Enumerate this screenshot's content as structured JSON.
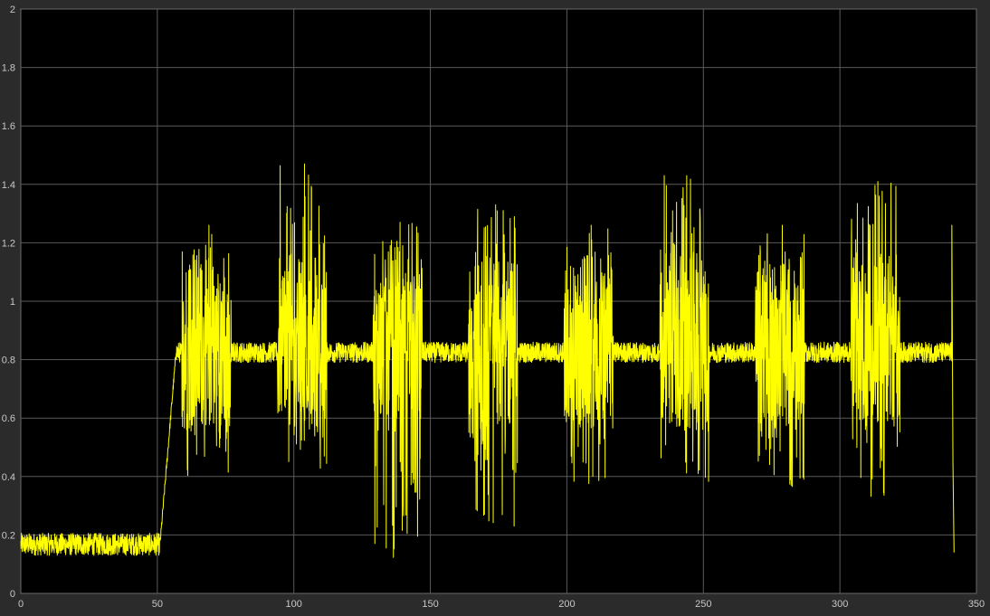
{
  "chart_data": {
    "type": "line",
    "title": "",
    "xlabel": "",
    "ylabel": "",
    "xlim": [
      0,
      350
    ],
    "ylim": [
      0,
      2
    ],
    "grid": true,
    "x_ticks": [
      "0",
      "50",
      "100",
      "150",
      "200",
      "250",
      "300",
      "350"
    ],
    "y_ticks": [
      "0",
      "0.2",
      "0.4",
      "0.6",
      "0.8",
      "1",
      "1.2",
      "1.4",
      "1.6",
      "1.8",
      "2"
    ],
    "series": [
      {
        "color": "#ffff00",
        "segments": [
          {
            "x_start": 0,
            "x_end": 51,
            "center": 0.165,
            "low": 0.13,
            "high": 0.21
          },
          {
            "x_start": 51,
            "x_end": 57,
            "ramp_from": 0.17,
            "ramp_to": 0.84
          }
        ],
        "baseline": {
          "x_start": 57,
          "x_end": 340,
          "low": 0.79,
          "high": 0.86
        },
        "bursts": [
          {
            "x_start": 59,
            "x_end": 77,
            "low": 0.35,
            "high": 1.26
          },
          {
            "x_start": 94,
            "x_end": 112,
            "low": 0.38,
            "high": 1.47
          },
          {
            "x_start": 129,
            "x_end": 147,
            "low": 0.12,
            "high": 1.27
          },
          {
            "x_start": 164,
            "x_end": 182,
            "low": 0.21,
            "high": 1.33
          },
          {
            "x_start": 199,
            "x_end": 217,
            "low": 0.36,
            "high": 1.26
          },
          {
            "x_start": 234,
            "x_end": 252,
            "low": 0.37,
            "high": 1.43
          },
          {
            "x_start": 269,
            "x_end": 287,
            "low": 0.33,
            "high": 1.26
          },
          {
            "x_start": 304,
            "x_end": 322,
            "low": 0.33,
            "high": 1.41
          }
        ],
        "end": {
          "x": 341,
          "spike_high": 1.26,
          "drop_to": 0.14
        }
      }
    ],
    "colors": {
      "plot_bg": "#000000",
      "figure_bg": "#2b2b2b",
      "grid": "#5a5a5a",
      "tick_text": "#c8c8c8",
      "line": "#ffff00"
    }
  }
}
